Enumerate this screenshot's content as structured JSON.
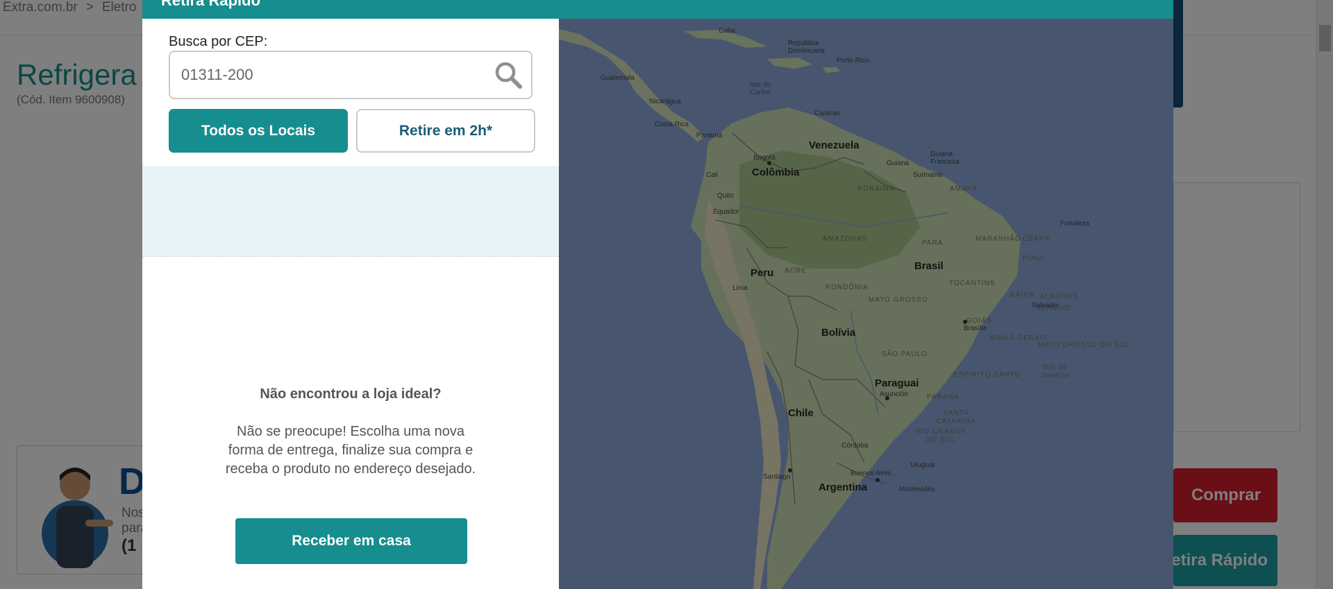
{
  "background_page": {
    "breadcrumb": [
      "Extra.com.br",
      ">",
      "Eletro"
    ],
    "product_title": "Refrigera",
    "product_code": "(Cód. Item 9600908)",
    "promo_big_text": "D",
    "promo_small_line1": "Nos",
    "promo_small_line2": "para",
    "promo_phone": "(1",
    "buy_button": "Comprar",
    "retira_button": "Retira Rápido"
  },
  "modal": {
    "title": "Retira Rápido",
    "cep_label": "Busca por CEP:",
    "cep_value": "01311-200",
    "buttons": {
      "todos": "Todos os Locais",
      "retire": "Retire em 2h*",
      "receber": "Receber em casa"
    },
    "notfound_title": "Não encontrou a loja ideal?",
    "notfound_text": "Não se preocupe! Escolha uma nova forma de entrega, finalize sua compra e receba o produto no endereço desejado.",
    "map": {
      "labels_big": [
        "Venezuela",
        "Colômbia",
        "Brasil",
        "Peru",
        "Bolívia",
        "Paraguai",
        "Chile",
        "Argentina"
      ],
      "labels_city": [
        "Cuba",
        "República Dominicana",
        "Porto Rico",
        "Guatemala",
        "Nicarágua",
        "Costa Rica",
        "Panamá",
        "Caracas",
        "Guiana",
        "Guiana Francesa",
        "Suriname",
        "Bogotá",
        "Cali",
        "Quito",
        "Equador",
        "Lima",
        "Fortaleza",
        "Salvador",
        "Brasília",
        "Rio de Janeiro",
        "Asunción",
        "Córdoba",
        "Santiago",
        "Buenos Aires",
        "Montevidéu",
        "Uruguai"
      ],
      "labels_region": [
        "RORAIMA",
        "AMAPÁ",
        "AMAZONAS",
        "PARÁ",
        "MARANHÃO",
        "CEARÁ",
        "PIAUÍ",
        "ACRE",
        "RONDÔNIA",
        "TOCANTINS",
        "BAHIA",
        "ALAGOAS",
        "SERGIPE",
        "MATO GROSSO",
        "GOIÁS",
        "MINAS GERAIS",
        "MATO GROSSO DO SUL",
        "SÃO PAULO",
        "ESPÍRITO SANTO",
        "PARANÁ",
        "SANTA CATARINA",
        "RIO GRANDE DO SUL",
        "PARÁ"
      ],
      "sea_label": "Mar do Caribe"
    }
  },
  "colors": {
    "teal": "#168d8f",
    "overlay": "rgba(0,0,0,0.5)",
    "store_area": "#e8f3f8",
    "buy_red": "#d41d2e"
  }
}
